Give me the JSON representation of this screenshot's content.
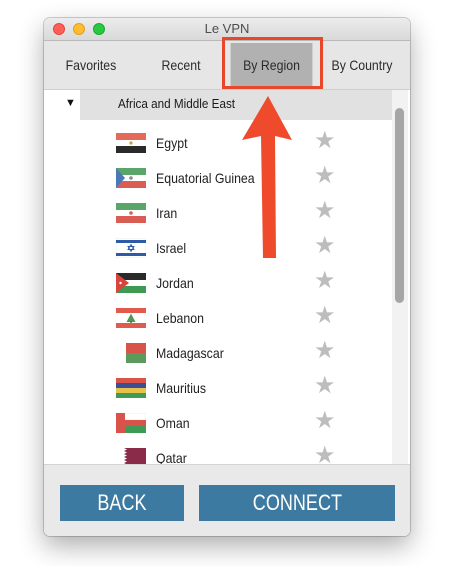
{
  "window": {
    "title": "Le VPN"
  },
  "tabs": [
    {
      "label": "Favorites"
    },
    {
      "label": "Recent"
    },
    {
      "label": "By Region",
      "selected": true
    },
    {
      "label": "By Country"
    }
  ],
  "group": {
    "label": "Africa and Middle East",
    "expanded": true
  },
  "countries": [
    {
      "name": "Egypt",
      "starred": false
    },
    {
      "name": "Equatorial Guinea",
      "starred": false
    },
    {
      "name": "Iran",
      "starred": false
    },
    {
      "name": "Israel",
      "starred": false
    },
    {
      "name": "Jordan",
      "starred": false
    },
    {
      "name": "Lebanon",
      "starred": false
    },
    {
      "name": "Madagascar",
      "starred": false
    },
    {
      "name": "Mauritius",
      "starred": false
    },
    {
      "name": "Oman",
      "starred": false
    },
    {
      "name": "Qatar",
      "starred": false
    }
  ],
  "buttons": {
    "back": "BACK",
    "connect": "CONNECT"
  },
  "colors": {
    "button": "#3d7aa1",
    "annotation": "#e8472a",
    "selected_tab": "#b1b1b1",
    "star": "#bdbdbd"
  }
}
